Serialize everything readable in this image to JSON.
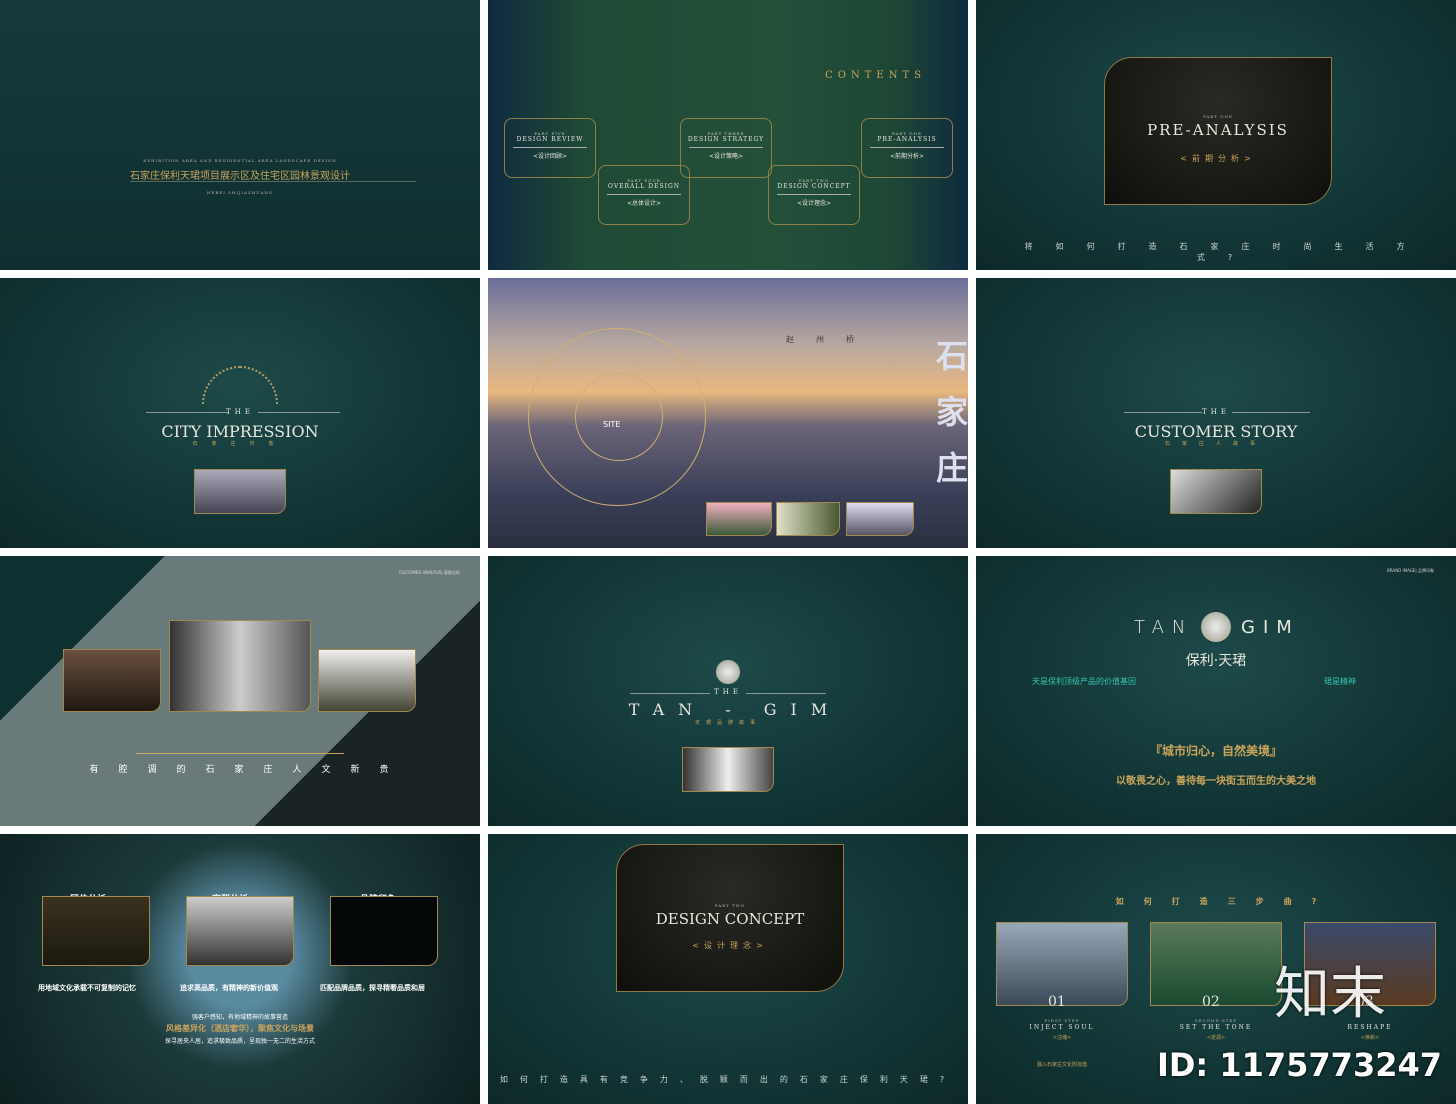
{
  "slides": {
    "s1": {
      "en": "EXHIBITION AREA AND RESIDENTIAL AREA LANDSCAPE DESIGN",
      "title": "石家庄保利天珺项目展示区及住宅区园林景观设计",
      "sub": "HEBEI SHIJIAZHUANG"
    },
    "s2": {
      "title": "CONTENTS",
      "parts": [
        {
          "part": "PART FIVE",
          "en": "DESIGN REVIEW",
          "zh": "<设计回顾>"
        },
        {
          "part": "PART FOUR",
          "en": "OVERALL DESIGN",
          "zh": "<总体设计>"
        },
        {
          "part": "PART THREE",
          "en": "DESIGN STRATEGY",
          "zh": "<设计策略>"
        },
        {
          "part": "PART TWO",
          "en": "DESIGN CONCEPT",
          "zh": "<设计理念>"
        },
        {
          "part": "PART ONE",
          "en": "PRE-ANALYSIS",
          "zh": "<前期分析>"
        }
      ]
    },
    "s3": {
      "part": "PART ONE",
      "title": "PRE-ANALYSIS",
      "zh": "<前期分析>",
      "question": "将如何打造石家庄时尚生活方式?"
    },
    "s4": {
      "the": "THE",
      "title": "CITY IMPRESSION",
      "zh": "石家庄印象"
    },
    "s5": {
      "label": "赵州桥",
      "site": "SITE",
      "vertical": "石家庄"
    },
    "s6": {
      "the": "THE",
      "title": "CUSTOMER STORY",
      "zh": "石家庄人故事"
    },
    "s7": {
      "tag": "CUSTOMER ANALYSIS| 客群分析",
      "headline": "有腔调的石家庄人文新贵"
    },
    "s8": {
      "the": "THE",
      "title": "TAN - GIM",
      "zh": "天珺品牌故事"
    },
    "s9": {
      "tag": "BRAND IMAGE| 品牌印象",
      "logo_left": "TAN",
      "logo_right": "GIM",
      "logo_zh": "保利·天珺",
      "left_head": "天是保利顶级产品的价值基因",
      "right_head": "珺是精神",
      "slogan": "『城市归心，自然美境』",
      "bottom": "以敬畏之心，善待每一块街玉而生的大美之地"
    },
    "s10": {
      "cols": [
        {
          "zh": "区位分析",
          "caption": "用地域文化承载不可复制的记忆"
        },
        {
          "zh": "客群分析",
          "caption": "追求高品质，有精神的新价值观"
        },
        {
          "zh": "品牌印象",
          "caption": "匹配品牌品质，探寻精奢品质和居"
        }
      ],
      "line1": "强客户感知，有地域精神的故事营造",
      "line2": "风格差异化（酒店奢华），聚焦文化与场景",
      "line3": "探寻居央人居，追求极致品质，呈现独一无二的生活方式"
    },
    "s11": {
      "part": "PART TWO",
      "title": "DESIGN CONCEPT",
      "zh": "<设计理念>",
      "question": "如何打造具有竞争力、脱颖而出的石家庄保利天珺?"
    },
    "s12": {
      "question": "如何打造三步曲?",
      "steps": [
        {
          "num": "01",
          "step": "FIRST STEP",
          "en": "INJECT SOUL",
          "zh": "<注魂>",
          "desc": "融入石家庄文化附加值"
        },
        {
          "num": "02",
          "step": "SECOND STEP",
          "en": "SET THE TONE",
          "zh": "<定调>"
        },
        {
          "num": "03",
          "en": "RESHAPE",
          "zh": "<焕新>"
        }
      ]
    }
  },
  "watermark": {
    "logo": "知末",
    "id": "ID: 1175773247"
  },
  "colors": {
    "bg": "#123535",
    "gold": "#c9a45a",
    "teal": "#37c4b0"
  }
}
